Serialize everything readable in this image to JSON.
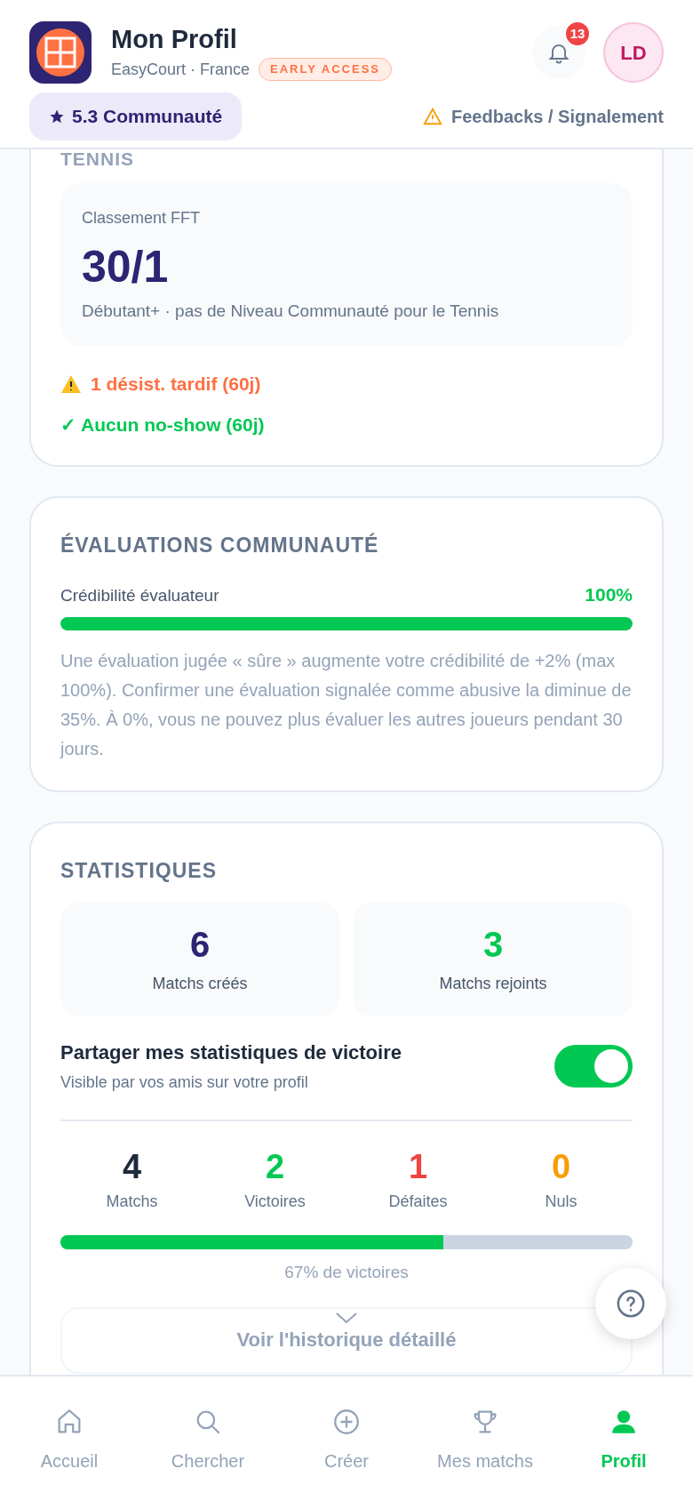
{
  "header": {
    "title": "Mon Profil",
    "subtitle": "EasyCourt · France",
    "badge": "EARLY ACCESS",
    "notifications": "13",
    "avatar": "LD",
    "rating": "5.3 Communauté",
    "feedback_link": "Feedbacks / Signalement"
  },
  "tennis_card": {
    "heading": "TENNIS",
    "ranking_label": "Classement FFT",
    "ranking": "30/1",
    "ranking_note": "Débutant+ · pas de Niveau Communauté pour le Tennis",
    "alerts": [
      {
        "kind": "warning",
        "text": "1 désist. tardif (60j)"
      },
      {
        "kind": "ok",
        "text": "✓ Aucun no-show (60j)"
      }
    ]
  },
  "evaluations_card": {
    "heading": "ÉVALUATIONS COMMUNAUTÉ",
    "label": "Crédibilité évaluateur",
    "reading": "100%",
    "level": 1,
    "description": "Une évaluation jugée « sûre » augmente votre crédibilité de +2% (max 100%). Confirmer une évaluation signalée comme abusive la diminue de 35%. À 0%, vous ne pouvez plus évaluer les autres joueurs pendant 30 jours."
  },
  "stats_card": {
    "heading": "STATISTIQUES",
    "tiles": [
      {
        "value": "6",
        "label": "Matchs créés",
        "color": "#2d2473"
      },
      {
        "value": "3",
        "label": "Matchs rejoints",
        "color": "#00c853"
      }
    ],
    "share": {
      "title": "Partager mes statistiques de victoire",
      "subtitle": "Visible par vos amis sur votre profil",
      "on": true
    },
    "results": [
      {
        "value": "4",
        "label": "Matchs",
        "color": "#1e293b"
      },
      {
        "value": "2",
        "label": "Victoires",
        "color": "#00c853"
      },
      {
        "value": "1",
        "label": "Défaites",
        "color": "#ef4444"
      },
      {
        "value": "0",
        "label": "Nuls",
        "color": "#f59e0b"
      }
    ],
    "win_rate": {
      "level": 0.67,
      "reading": "67% de victoires"
    },
    "history_button": "Voir l'historique détaillé"
  },
  "nav": [
    {
      "label": "Accueil",
      "kind": "home",
      "selected": false
    },
    {
      "label": "Chercher",
      "kind": "search",
      "selected": false
    },
    {
      "label": "Créer",
      "kind": "create",
      "selected": false
    },
    {
      "label": "Mes matchs",
      "kind": "matches",
      "selected": false
    },
    {
      "label": "Profil",
      "kind": "profile",
      "selected": true
    }
  ]
}
